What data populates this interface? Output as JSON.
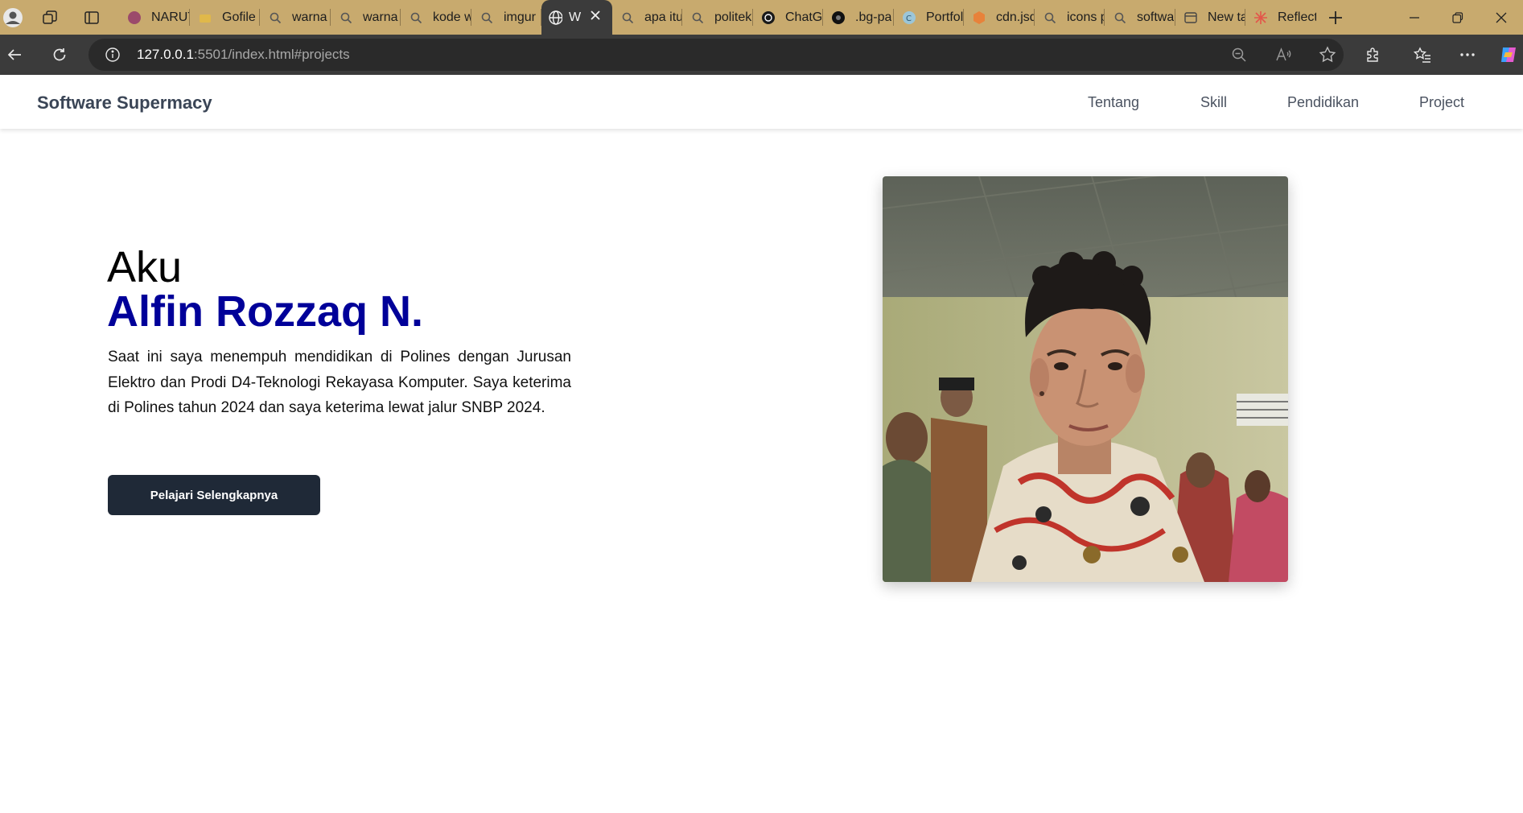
{
  "browser": {
    "tabs": [
      {
        "title": "NARUTO"
      },
      {
        "title": "Gofile"
      },
      {
        "title": "warna"
      },
      {
        "title": "warna"
      },
      {
        "title": "kode w"
      },
      {
        "title": "imgur"
      },
      {
        "title": "W",
        "active": true
      },
      {
        "title": "apa itu"
      },
      {
        "title": "politek"
      },
      {
        "title": "ChatG"
      },
      {
        "title": ".bg-pa"
      },
      {
        "title": "Portfol"
      },
      {
        "title": "cdn.jsd"
      },
      {
        "title": "icons p"
      },
      {
        "title": "softwa"
      },
      {
        "title": "New ta"
      },
      {
        "title": "Reflect"
      }
    ],
    "url": {
      "host": "127.0.0.1",
      "rest": ":5501/index.html#projects"
    }
  },
  "site": {
    "brand": "Software Supermacy",
    "nav": [
      "Tentang",
      "Skill",
      "Pendidikan",
      "Project"
    ]
  },
  "hero": {
    "greeting": "Aku",
    "name": "Alfin Rozzaq N.",
    "description": "Saat ini saya menempuh mendidikan di Polines dengan Jurusan Elektro dan Prodi D4-Teknologi Rekayasa Komputer. Saya keterima di Polines tahun 2024 dan saya keterima lewat jalur SNBP 2024.",
    "button_label": "Pelajari Selengkapnya"
  },
  "colors": {
    "name_accent": "#000099",
    "button_bg": "#1f2937",
    "tabbar_bg": "#c8aa6e",
    "toolbar_bg": "#3b3b3b"
  }
}
